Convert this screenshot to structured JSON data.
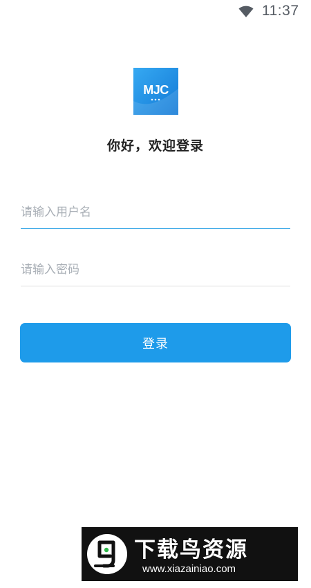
{
  "status_bar": {
    "time": "11:37",
    "wifi_icon": "wifi-icon"
  },
  "app": {
    "logo_text": "MJC",
    "welcome": "你好，欢迎登录"
  },
  "form": {
    "username_placeholder": "请输入用户名",
    "username_value": "",
    "password_placeholder": "请输入密码",
    "password_value": "",
    "login_label": "登录"
  },
  "watermark": {
    "title": "下载鸟资源",
    "url": "www.xiazainiao.com"
  },
  "colors": {
    "accent": "#1e9bea",
    "logo_blue": "#1f8fe6",
    "field_active_line": "#33a5e6",
    "field_line": "#dddddd",
    "placeholder": "#a9afb6",
    "status_text": "#555b63"
  }
}
